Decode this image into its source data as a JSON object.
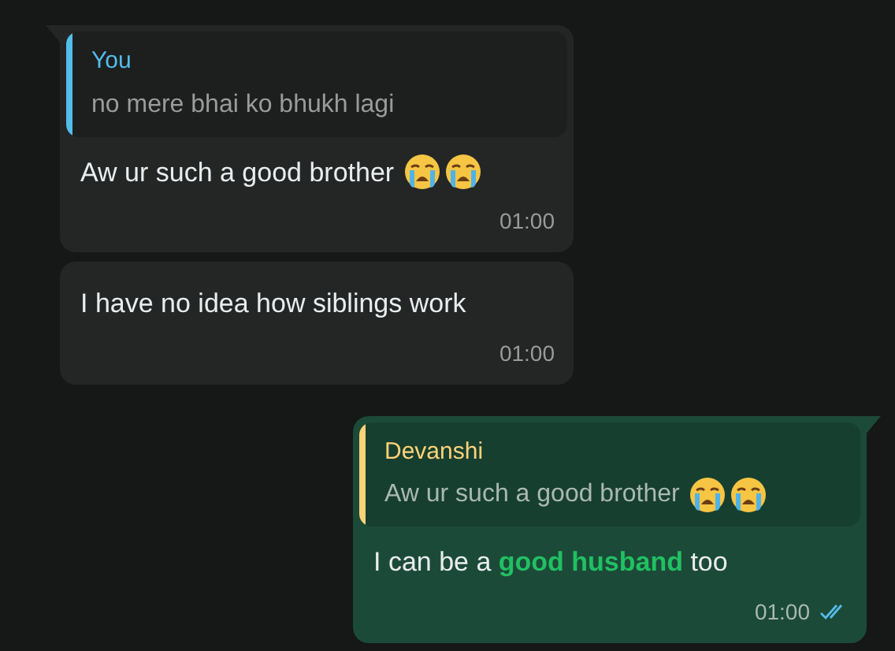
{
  "messages": [
    {
      "kind": "incoming",
      "tail": true,
      "quote": {
        "author": "You",
        "color": "#53bdeb",
        "text": "no mere bhai ko bhukh lagi"
      },
      "text": "Aw ur such a good brother",
      "emojis": [
        {
          "kind": "crying"
        },
        {
          "kind": "crying"
        }
      ],
      "time": "01:00"
    },
    {
      "kind": "incoming",
      "tail": false,
      "text": "I have no idea how siblings work",
      "time": "01:00"
    },
    {
      "kind": "outgoing",
      "tail": true,
      "quote": {
        "author": "Devanshi",
        "color": "#ffd279",
        "text": "Aw ur such a good brother",
        "emojis": [
          {
            "kind": "crying"
          },
          {
            "kind": "crying"
          }
        ]
      },
      "text": "I can be a **good husband** too",
      "time": "01:00",
      "read": true
    }
  ]
}
